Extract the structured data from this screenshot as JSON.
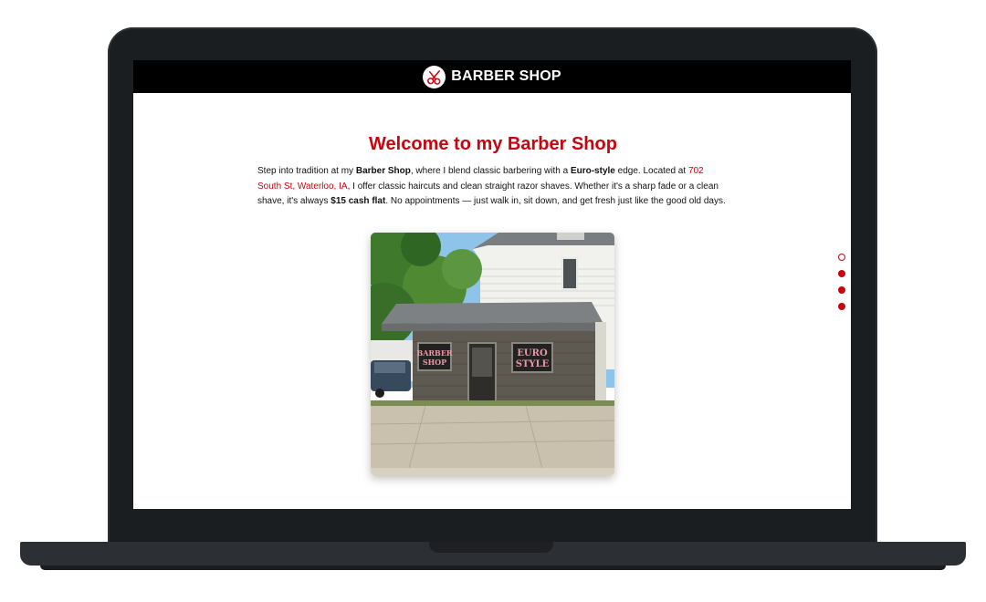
{
  "brand": {
    "name": "BARBER SHOP",
    "logo_icon": "scissors-icon"
  },
  "main": {
    "title": "Welcome to my Barber Shop",
    "intro": {
      "p1": "Step into tradition at my ",
      "b1": "Barber Shop",
      "p2": ", where I blend classic barbering with a ",
      "b2": "Euro-style",
      "p3": " edge. Located at ",
      "address": "702 South St, Waterloo, IA",
      "p4": ", I offer classic haircuts and clean straight razor shaves. Whether it's a sharp fade or a clean shave, it's always ",
      "b3": "$15 cash flat",
      "p5": ". No appointments — just walk in, sit down, and get fresh just like the good old days."
    },
    "photo": {
      "sign_left": "BARBER SHOP",
      "sign_right": "EURO STYLE",
      "sign_left_1": "BARBER",
      "sign_left_2": "SHOP",
      "sign_right_1": "EURO",
      "sign_right_2": "STYLE"
    }
  },
  "slide_nav": {
    "count": 4,
    "active_index": 0
  },
  "colors": {
    "accent": "#c8050f",
    "navbar": "#000000",
    "frame": "#1b1e21"
  }
}
